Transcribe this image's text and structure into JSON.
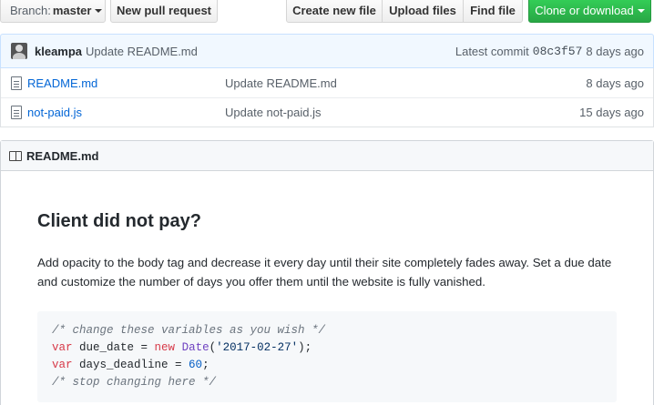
{
  "toolbar": {
    "branch_label": "Branch:",
    "branch_name": "master",
    "new_pr": "New pull request",
    "create_file": "Create new file",
    "upload_files": "Upload files",
    "find_file": "Find file",
    "clone": "Clone or download"
  },
  "commit": {
    "author": "kleampa",
    "message": "Update README.md",
    "latest_label": "Latest commit",
    "sha": "08c3f57",
    "date": "8 days ago"
  },
  "files": [
    {
      "name": "README.md",
      "message": "Update README.md",
      "age": "8 days ago"
    },
    {
      "name": "not-paid.js",
      "message": "Update not-paid.js",
      "age": "15 days ago"
    }
  ],
  "readme": {
    "title": "README.md",
    "heading": "Client did not pay?",
    "paragraph": "Add opacity to the body tag and decrease it every day until their site completely fades away. Set a due date and customize the number of days you offer them until the website is fully vanished.",
    "code": {
      "line1": "/* change these variables as you wish */",
      "line2_kw": "var",
      "line2_a": " due_date = ",
      "line2_new": "new",
      "line2_fn": "Date",
      "line2_b": "(",
      "line2_str": "'2017-02-27'",
      "line2_c": ");",
      "line3_kw": "var",
      "line3_a": " days_deadline = ",
      "line3_num": "60",
      "line3_b": ";",
      "line4": "/* stop changing here */"
    }
  },
  "colors": {
    "accent_link": "#0366d6",
    "clone_green": "#28a745",
    "commit_bar_bg": "#f1f8ff"
  }
}
